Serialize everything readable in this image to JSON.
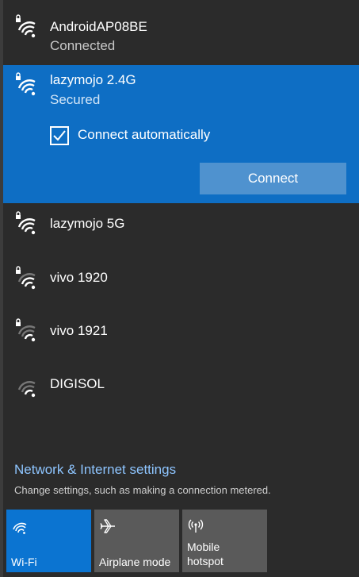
{
  "networks": [
    {
      "name": "AndroidAP08BE",
      "status": "Connected",
      "secured": true,
      "strength": "full"
    },
    {
      "name": "lazymojo 2.4G",
      "status": "Secured",
      "secured": true,
      "strength": "full"
    },
    {
      "name": "lazymojo 5G",
      "secured": true,
      "strength": "full"
    },
    {
      "name": "vivo 1920",
      "secured": true,
      "strength": "medium"
    },
    {
      "name": "vivo 1921",
      "secured": true,
      "strength": "low"
    },
    {
      "name": "DIGISOL",
      "secured": false,
      "strength": "low"
    }
  ],
  "selected": {
    "auto_connect_label": "Connect automatically",
    "auto_connect_checked": true,
    "connect_label": "Connect"
  },
  "settings": {
    "link": "Network & Internet settings",
    "description": "Change settings, such as making a connection metered."
  },
  "quick_actions": [
    {
      "label": "Wi-Fi",
      "icon": "wifi-icon",
      "active": true
    },
    {
      "label": "Airplane mode",
      "icon": "airplane-icon",
      "active": false
    },
    {
      "label_line1": "Mobile",
      "label_line2": "hotspot",
      "icon": "hotspot-icon",
      "active": false
    }
  ],
  "colors": {
    "background": "#2b2b2b",
    "selected": "#0e6ec4",
    "connect_button": "#4f92cf",
    "link": "#8ec5ff",
    "tile_active": "#0b74d1",
    "tile_inactive": "#5a5a5a"
  }
}
